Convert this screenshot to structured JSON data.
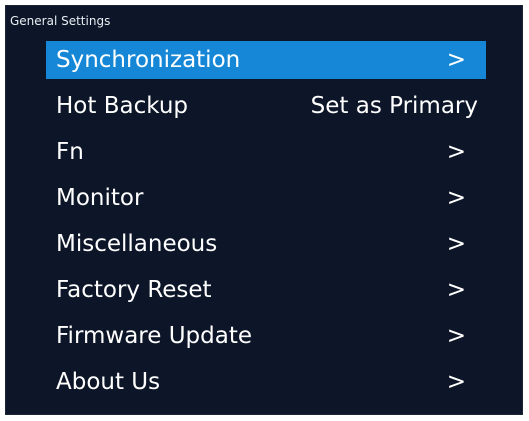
{
  "screen": {
    "title": "General Settings"
  },
  "colors": {
    "background": "#0c1628",
    "highlight": "#1587d6",
    "text": "#ffffff"
  },
  "menu": {
    "items": [
      {
        "label": "Synchronization",
        "value": ">",
        "selected": true
      },
      {
        "label": "Hot Backup",
        "value": "Set as Primary",
        "selected": false
      },
      {
        "label": "Fn",
        "value": ">",
        "selected": false
      },
      {
        "label": "Monitor",
        "value": ">",
        "selected": false
      },
      {
        "label": "Miscellaneous",
        "value": ">",
        "selected": false
      },
      {
        "label": "Factory Reset",
        "value": ">",
        "selected": false
      },
      {
        "label": "Firmware Update",
        "value": ">",
        "selected": false
      },
      {
        "label": "About Us",
        "value": ">",
        "selected": false
      }
    ]
  }
}
